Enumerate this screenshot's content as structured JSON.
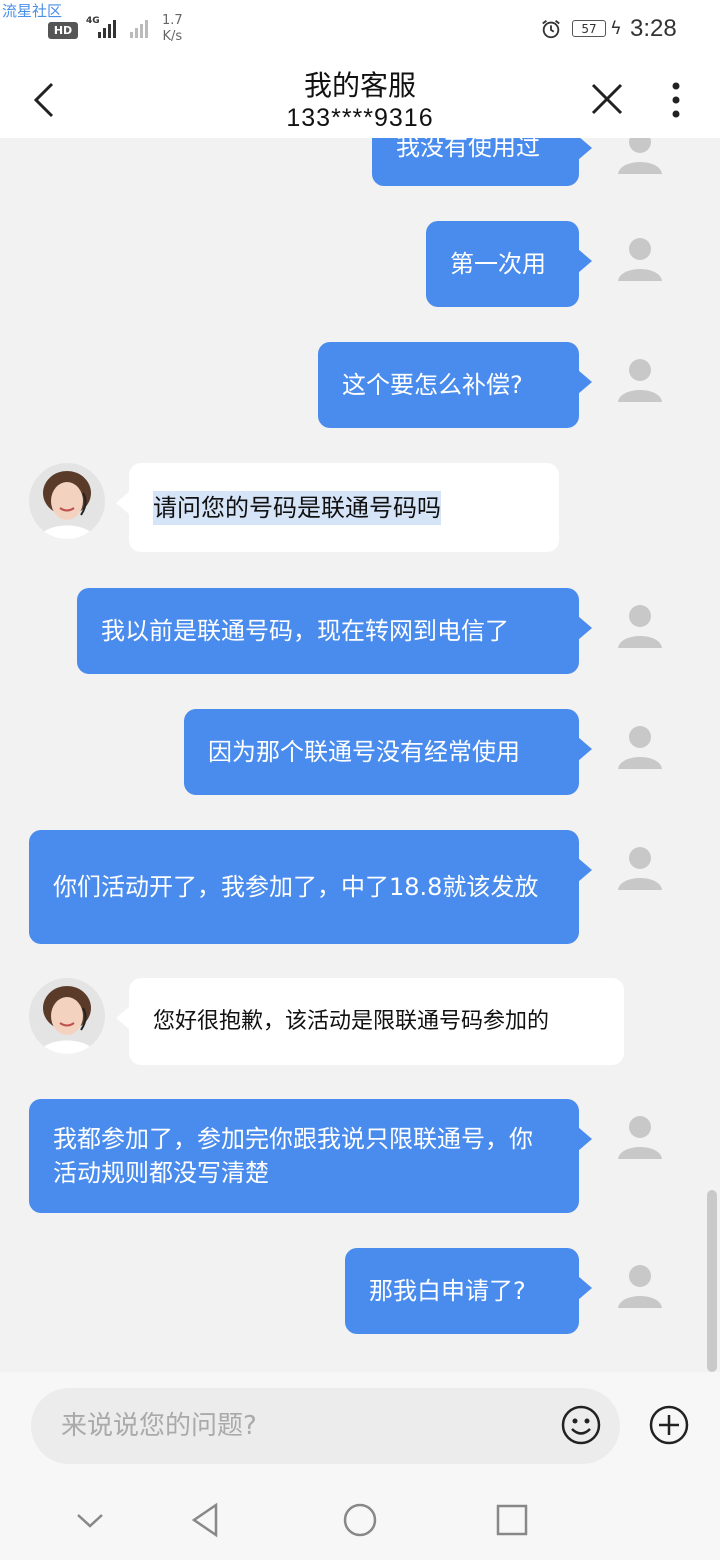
{
  "status_bar": {
    "watermark": "流星社区",
    "hd": "HD",
    "network": "4G",
    "speed_value": "1.7",
    "speed_unit": "K/s",
    "battery": "57",
    "time": "3:28"
  },
  "header": {
    "title": "我的客服",
    "subtitle": "133****9316"
  },
  "messages": [
    {
      "from": "user",
      "text": "我没有使用过"
    },
    {
      "from": "user",
      "text": "第一次用"
    },
    {
      "from": "user",
      "text": "这个要怎么补偿?"
    },
    {
      "from": "agent",
      "text": "请问您的号码是联通号码吗"
    },
    {
      "from": "user",
      "text": "我以前是联通号码，现在转网到电信了"
    },
    {
      "from": "user",
      "text": "因为那个联通号没有经常使用"
    },
    {
      "from": "user",
      "text": "你们活动开了，我参加了，中了18.8就该发放"
    },
    {
      "from": "agent",
      "text": "您好很抱歉，该活动是限联通号码参加的"
    },
    {
      "from": "user",
      "text": "我都参加了，参加完你跟我说只限联通号，你活动规则都没写清楚"
    },
    {
      "from": "user",
      "text": "那我白申请了?"
    }
  ],
  "input": {
    "placeholder": "来说说您的问题?"
  },
  "colors": {
    "user_bubble": "#4a8ced",
    "agent_bubble": "#ffffff",
    "background": "#f2f2f2"
  },
  "icons": {
    "back": "chevron-left-icon",
    "close": "close-icon",
    "more": "more-vertical-icon",
    "emoji": "smiley-icon",
    "add": "plus-circle-icon",
    "nav_down": "chevron-down-icon",
    "nav_back": "triangle-back-icon",
    "nav_home": "circle-home-icon",
    "nav_recent": "square-recents-icon"
  }
}
